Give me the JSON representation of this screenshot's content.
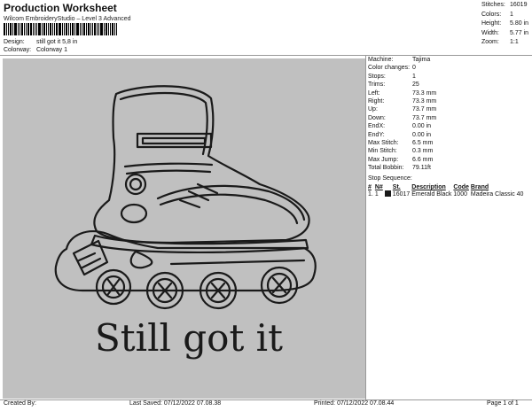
{
  "header": {
    "title": "Production Worksheet",
    "subtitle": "Wilcom EmbroideryStudio – Level 3 Advanced",
    "design_label": "Design:",
    "design_value": "still got it 5,8 in",
    "colorway_label": "Colorway:",
    "colorway_value": "Colorway 1"
  },
  "summary": [
    {
      "label": "Stitches:",
      "value": "16019"
    },
    {
      "label": "Colors:",
      "value": "1"
    },
    {
      "label": "Height:",
      "value": "5.80 in"
    },
    {
      "label": "Width:",
      "value": "5.77 in"
    },
    {
      "label": "Zoom:",
      "value": "1:1"
    }
  ],
  "machine_info": [
    {
      "label": "Machine:",
      "value": "Tajima"
    },
    {
      "label": "Color changes:",
      "value": "0"
    },
    {
      "label": "Stops:",
      "value": "1"
    },
    {
      "label": "Trims:",
      "value": "25"
    },
    {
      "label": "Left:",
      "value": "73.3 mm"
    },
    {
      "label": "Right:",
      "value": "73.3 mm"
    },
    {
      "label": "Up:",
      "value": "73.7 mm"
    },
    {
      "label": "Down:",
      "value": "73.7 mm"
    },
    {
      "label": "EndX:",
      "value": "0.00 in"
    },
    {
      "label": "EndY:",
      "value": "0.00 in"
    },
    {
      "label": "Max Stitch:",
      "value": "6.5 mm"
    },
    {
      "label": "Min Stitch:",
      "value": "0.3 mm"
    },
    {
      "label": "Max Jump:",
      "value": "6.6 mm"
    },
    {
      "label": "Total Bobbin:",
      "value": "79.11ft"
    }
  ],
  "stop_sequence": {
    "title": "Stop Sequence:",
    "headers": [
      "#",
      "N#",
      "",
      "St.",
      "Description",
      "Code",
      "Brand"
    ],
    "rows": [
      {
        "num": "1.",
        "n": "1",
        "swatch_color": "#1a1a1a",
        "stitches": "16017",
        "description": "Emerald Black",
        "code": "1000",
        "brand": "Madeira Classic 40"
      }
    ]
  },
  "design_text": "Still got it",
  "footer": {
    "created": "Created By:",
    "last_saved": "Last Saved: 07/12/2022 07.08.38",
    "printed": "Printed: 07/12/2022 07.08.44",
    "page": "Page 1 of 1"
  },
  "colors": {
    "canvas_bg": "#c0c0c0",
    "thread": "#1a1a1a"
  }
}
